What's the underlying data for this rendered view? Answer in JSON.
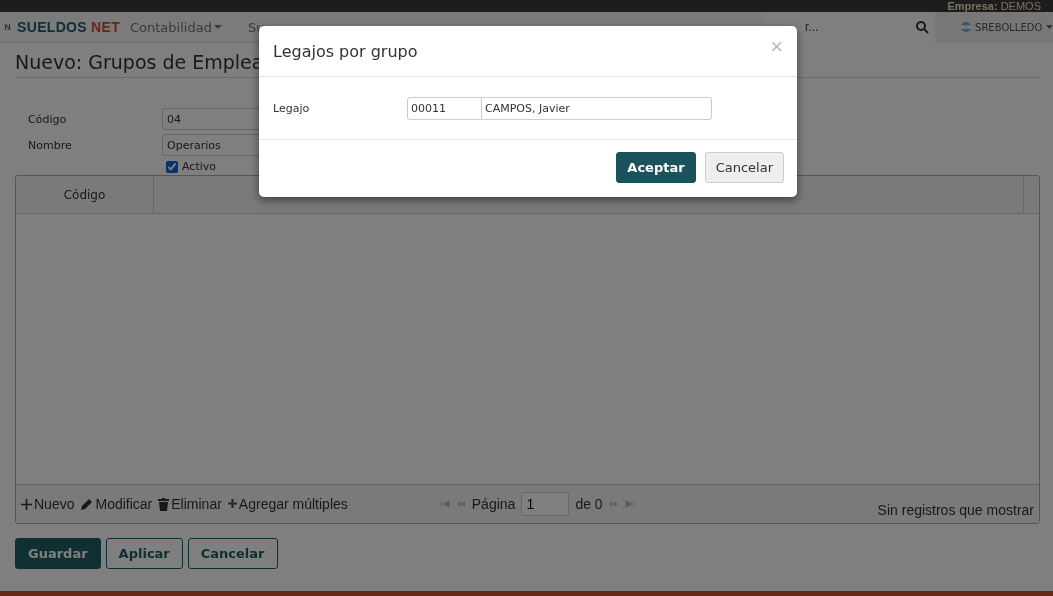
{
  "top_bar": {
    "label": "Empresa:",
    "company": "DEMOS"
  },
  "navbar": {
    "brand_first": "SUELDOS",
    "brand_second": "NET",
    "menu": [
      {
        "label": "Contabilidad",
        "dropdown": true
      },
      {
        "label": "Su",
        "dropdown": false
      }
    ],
    "search": {
      "placeholder": "r..."
    },
    "user": "SREBOLLEDO"
  },
  "page": {
    "title": "Nuevo: Grupos de Emplea",
    "fields": [
      {
        "label": "Código",
        "value": "04"
      },
      {
        "label": "Nombre",
        "value": "Operarios"
      }
    ],
    "active": {
      "label": "Activo",
      "checked": true
    },
    "grid": {
      "columns": [
        "Código"
      ],
      "toolbar": [
        {
          "kind": "plus",
          "label": "Nuevo"
        },
        {
          "kind": "pencil",
          "label": "Modificar"
        },
        {
          "kind": "trash",
          "label": "Eliminar"
        },
        {
          "kind": "plus-small",
          "label": "Agregar múltiples"
        }
      ],
      "pager": {
        "page_label": "Página",
        "page": "1",
        "of_label": "de 0"
      },
      "status": "Sin registros que mostrar"
    },
    "buttons": [
      {
        "label": "Guardar",
        "primary": true
      },
      {
        "label": "Aplicar",
        "primary": false
      },
      {
        "label": "Cancelar",
        "primary": false
      }
    ]
  },
  "modal": {
    "title": "Legajos por grupo",
    "close": "×",
    "field": {
      "label": "Legajo",
      "code": "00011",
      "name": "CAMPOS, Javier"
    },
    "buttons": [
      {
        "label": "Aceptar",
        "primary": true
      },
      {
        "label": "Cancelar",
        "primary": false
      }
    ]
  }
}
